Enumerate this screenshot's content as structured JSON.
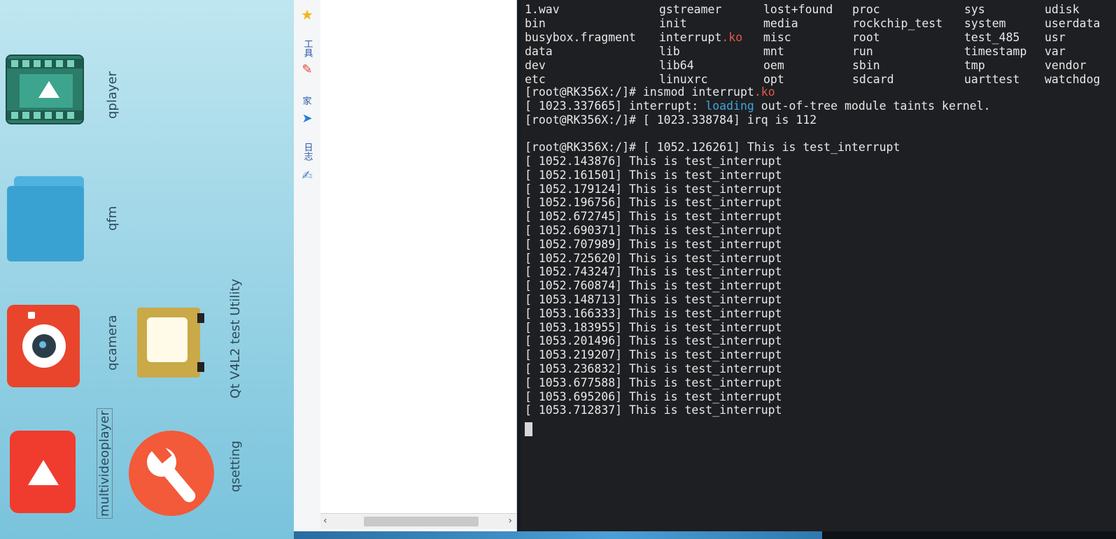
{
  "device": {
    "apps": [
      {
        "label": "qplayer"
      },
      {
        "label": "qfm"
      },
      {
        "label": "qcamera"
      },
      {
        "label": "Qt V4L2 test Utility"
      },
      {
        "label": "multivideoplayer"
      },
      {
        "label": "qsetting"
      }
    ]
  },
  "sidebar": {
    "tools_label": "工具",
    "home_label": "家",
    "log_label": "日志"
  },
  "terminal": {
    "ls_columns": [
      [
        "1.wav",
        "bin",
        "busybox.fragment",
        "data",
        "dev",
        "etc"
      ],
      [
        "gstreamer",
        "init",
        "interrupt.ko",
        "lib",
        "lib64",
        "linuxrc"
      ],
      [
        "lost+found",
        "media",
        "misc",
        "mnt",
        "oem",
        "opt"
      ],
      [
        "proc",
        "rockchip_test",
        "root",
        "run",
        "sbin",
        "sdcard"
      ],
      [
        "sys",
        "system",
        "test_485",
        "timestamp",
        "tmp",
        "uarttest"
      ],
      [
        "udisk",
        "userdata",
        "usr",
        "var",
        "vendor",
        "watchdog"
      ]
    ],
    "insmod_prompt": "[root@RK356X:/]# insmod interrupt",
    "insmod_ext": ".ko",
    "kernel_prefix": "[ 1023.337665] interrupt: ",
    "kernel_loading": "loading",
    "kernel_suffix": " out-of-tree module taints kernel.",
    "irq_line": "[root@RK356X:/]# [ 1023.338784] irq is 112",
    "first_interrupt": "[root@RK356X:/]# [ 1052.126261] This is test_interrupt",
    "interrupt_lines": [
      "[ 1052.143876] This is test_interrupt",
      "[ 1052.161501] This is test_interrupt",
      "[ 1052.179124] This is test_interrupt",
      "[ 1052.196756] This is test_interrupt",
      "[ 1052.672745] This is test_interrupt",
      "[ 1052.690371] This is test_interrupt",
      "[ 1052.707989] This is test_interrupt",
      "[ 1052.725620] This is test_interrupt",
      "[ 1052.743247] This is test_interrupt",
      "[ 1052.760874] This is test_interrupt",
      "[ 1053.148713] This is test_interrupt",
      "[ 1053.166333] This is test_interrupt",
      "[ 1053.183955] This is test_interrupt",
      "[ 1053.201496] This is test_interrupt",
      "[ 1053.219207] This is test_interrupt",
      "[ 1053.236832] This is test_interrupt",
      "[ 1053.677588] This is test_interrupt",
      "[ 1053.695206] This is test_interrupt",
      "[ 1053.712837] This is test_interrupt"
    ]
  },
  "colors": {
    "accent_red": "#e25a4a",
    "accent_blue": "#3ea6dc",
    "terminal_bg": "#1e1f22"
  }
}
